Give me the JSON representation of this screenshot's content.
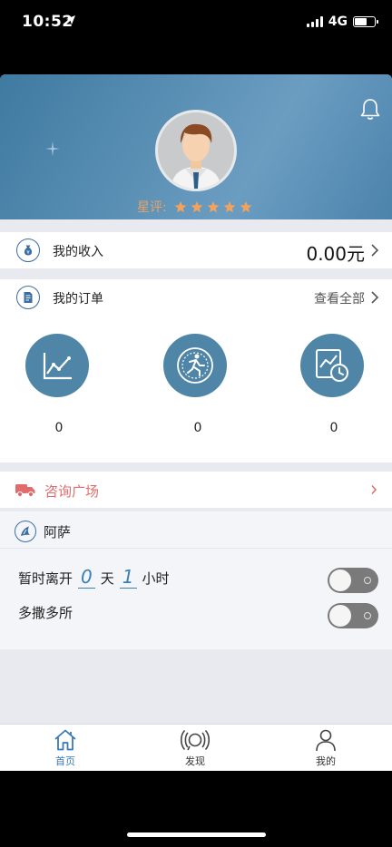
{
  "status_bar": {
    "time": "10:52",
    "network": "4G"
  },
  "header": {
    "rating_label": "星评:",
    "stars": 5,
    "star_color": "#f0a25e"
  },
  "income": {
    "label": "我的收入",
    "value": "0.00元"
  },
  "orders": {
    "label": "我的订单",
    "see_all": "查看全部",
    "stats": [
      {
        "icon": "line-chart-icon",
        "count": "0"
      },
      {
        "icon": "coin-runner-icon",
        "count": "0"
      },
      {
        "icon": "chart-clock-icon",
        "count": "0"
      }
    ]
  },
  "consult": {
    "label": "咨询广场"
  },
  "profile": {
    "name": "阿萨",
    "leave_prefix": "暂时离开",
    "leave_days": "0",
    "days_unit": "天",
    "leave_hours": "1",
    "hours_unit": "小时",
    "busy_label": "多撒多所"
  },
  "tabbar": {
    "tabs": [
      {
        "label": "首页",
        "icon": "home-icon",
        "active": true
      },
      {
        "label": "发现",
        "icon": "broadcast-icon",
        "active": false
      },
      {
        "label": "我的",
        "icon": "person-icon",
        "active": false
      }
    ]
  },
  "colors": {
    "accent": "#3a79b7",
    "header": "#5a8fb4",
    "stat_circle": "#4f86a7",
    "consult": "#e06c6c"
  }
}
